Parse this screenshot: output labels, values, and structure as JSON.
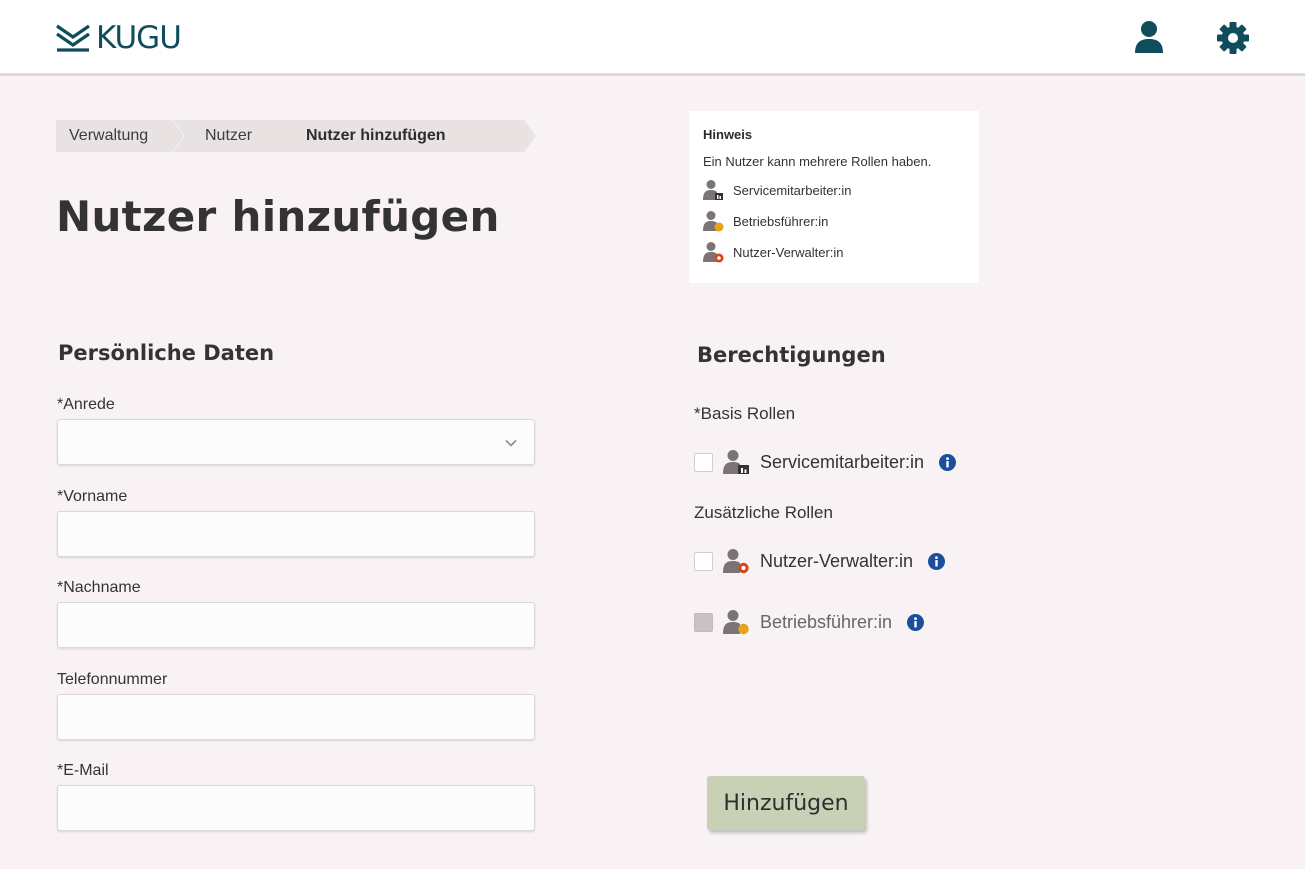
{
  "header": {
    "logo_text": "KUGU",
    "user_icon": "user-icon",
    "settings_icon": "gear-icon",
    "brand_color": "#0f4d5c"
  },
  "breadcrumb": [
    "Verwaltung",
    "Nutzer",
    "Nutzer hinzufügen"
  ],
  "page_title": "Nutzer hinzufügen",
  "hint": {
    "title": "Hinweis",
    "text": "Ein Nutzer kann mehrere Rollen haben.",
    "roles": [
      "Servicemitarbeiter:in",
      "Betriebsführer:in",
      "Nutzer-Verwalter:in"
    ]
  },
  "personal": {
    "title": "Persönliche Daten",
    "salutation_label": "*Anrede",
    "salutation_value": "",
    "firstname_label": "*Vorname",
    "lastname_label": "*Nachname",
    "phone_label": "Telefonnummer",
    "email_label": "*E-Mail"
  },
  "permissions": {
    "title": "Berechtigungen",
    "basic_roles_label": "*Basis Rollen",
    "additional_roles_label": "Zusätzliche Rollen",
    "service_role": "Servicemitarbeiter:in",
    "admin_role": "Nutzer-Verwalter:in",
    "operator_role": "Betriebsführer:in"
  },
  "add_button_label": "Hinzufügen",
  "colors": {
    "background": "#f8f2f4",
    "button": "#c8d0b5",
    "info": "#1a4f9c",
    "role_badge_orange": "#e8a317",
    "role_badge_red": "#d9451c"
  }
}
